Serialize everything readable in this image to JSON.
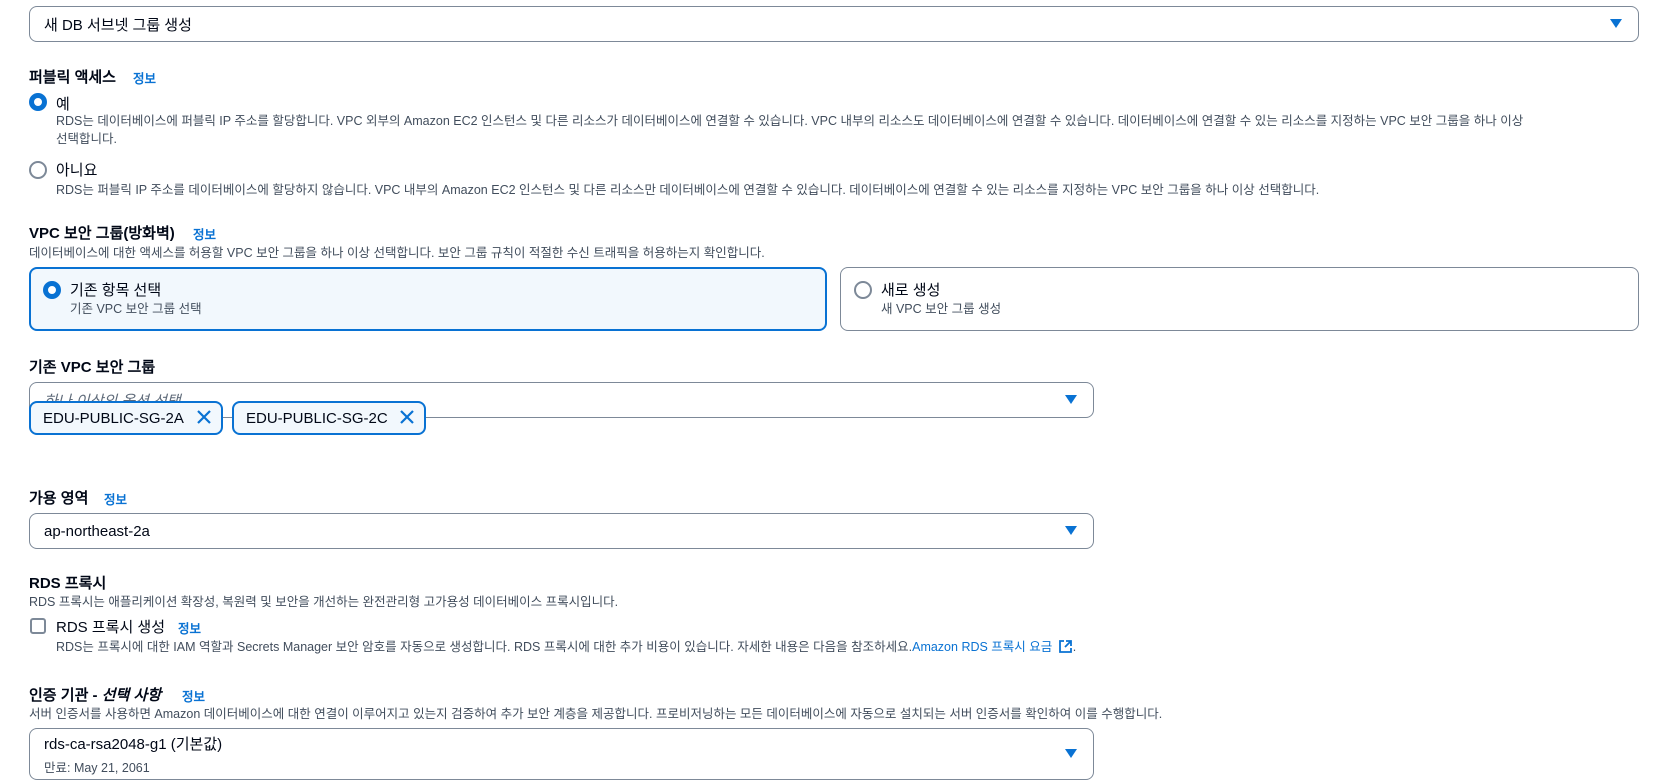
{
  "subnet_group": {
    "selected": "새 DB 서브넷 그룹 생성"
  },
  "public_access": {
    "label": "퍼블릭 액세스",
    "info": "정보",
    "options": [
      {
        "label": "예",
        "checked": true,
        "desc_line1": "RDS는 데이터베이스에 퍼블릭 IP 주소를 할당합니다. VPC 외부의 Amazon EC2 인스턴스 및 다른 리소스가 데이터베이스에 연결할 수 있습니다. VPC 내부의 리소스도 데이터베이스에 연결할 수 있습니다. 데이터베이스에 연결할 수 있는 리소스를 지정하는 VPC 보안 그룹을 하나 이상",
        "desc_line2": "선택합니다."
      },
      {
        "label": "아니요",
        "checked": false,
        "desc_line1": "RDS는 퍼블릭 IP 주소를 데이터베이스에 할당하지 않습니다. VPC 내부의 Amazon EC2 인스턴스 및 다른 리소스만 데이터베이스에 연결할 수 있습니다. 데이터베이스에 연결할 수 있는 리소스를 지정하는 VPC 보안 그룹을 하나 이상 선택합니다."
      }
    ]
  },
  "vpc_sg": {
    "label": "VPC 보안 그룹(방화벽)",
    "info": "정보",
    "description": "데이터베이스에 대한 액세스를 허용할 VPC 보안 그룹을 하나 이상 선택합니다. 보안 그룹 규칙이 적절한 수신 트래픽을 허용하는지 확인합니다.",
    "tiles": [
      {
        "title": "기존 항목 선택",
        "subtitle": "기존 VPC 보안 그룹 선택",
        "selected": true
      },
      {
        "title": "새로 생성",
        "subtitle": "새 VPC 보안 그룹 생성",
        "selected": false
      }
    ]
  },
  "existing_sg": {
    "label": "기존 VPC 보안 그룹",
    "placeholder": "하나 이상의 옵션 선택",
    "tokens": [
      "EDU-PUBLIC-SG-2A",
      "EDU-PUBLIC-SG-2C"
    ]
  },
  "az": {
    "label": "가용 영역",
    "info": "정보",
    "selected": "ap-northeast-2a"
  },
  "rds_proxy": {
    "label": "RDS 프록시",
    "description": "RDS 프록시는 애플리케이션 확장성, 복원력 및 보안을 개선하는 완전관리형 고가용성 데이터베이스 프록시입니다.",
    "checkbox_label": "RDS 프록시 생성",
    "info": "정보",
    "checkbox_desc": "RDS는 프록시에 대한 IAM 역할과 Secrets Manager 보안 암호를 자동으로 생성합니다. RDS 프록시에 대한 추가 비용이 있습니다. 자세한 내용은 다음을 참조하세요.",
    "link": "Amazon RDS 프록시 요금",
    "link_suffix": "."
  },
  "ca": {
    "label": "인증 기관 -",
    "label_optional": "선택 사항",
    "info": "정보",
    "description": "서버 인증서를 사용하면 Amazon 데이터베이스에 대한 연결이 이루어지고 있는지 검증하여 추가 보안 계층을 제공합니다. 프로비저닝하는 모든 데이터베이스에 자동으로 설치되는 서버 인증서를 확인하여 이를 수행합니다.",
    "selected": "rds-ca-rsa2048-g1 (기본값)",
    "expiry": "만료: May 21, 2061"
  },
  "colors": {
    "accent": "#0972d3",
    "border": "#7d8998",
    "selected_bg": "#f2f8fd",
    "text": "#000716",
    "muted": "#414d5c"
  }
}
